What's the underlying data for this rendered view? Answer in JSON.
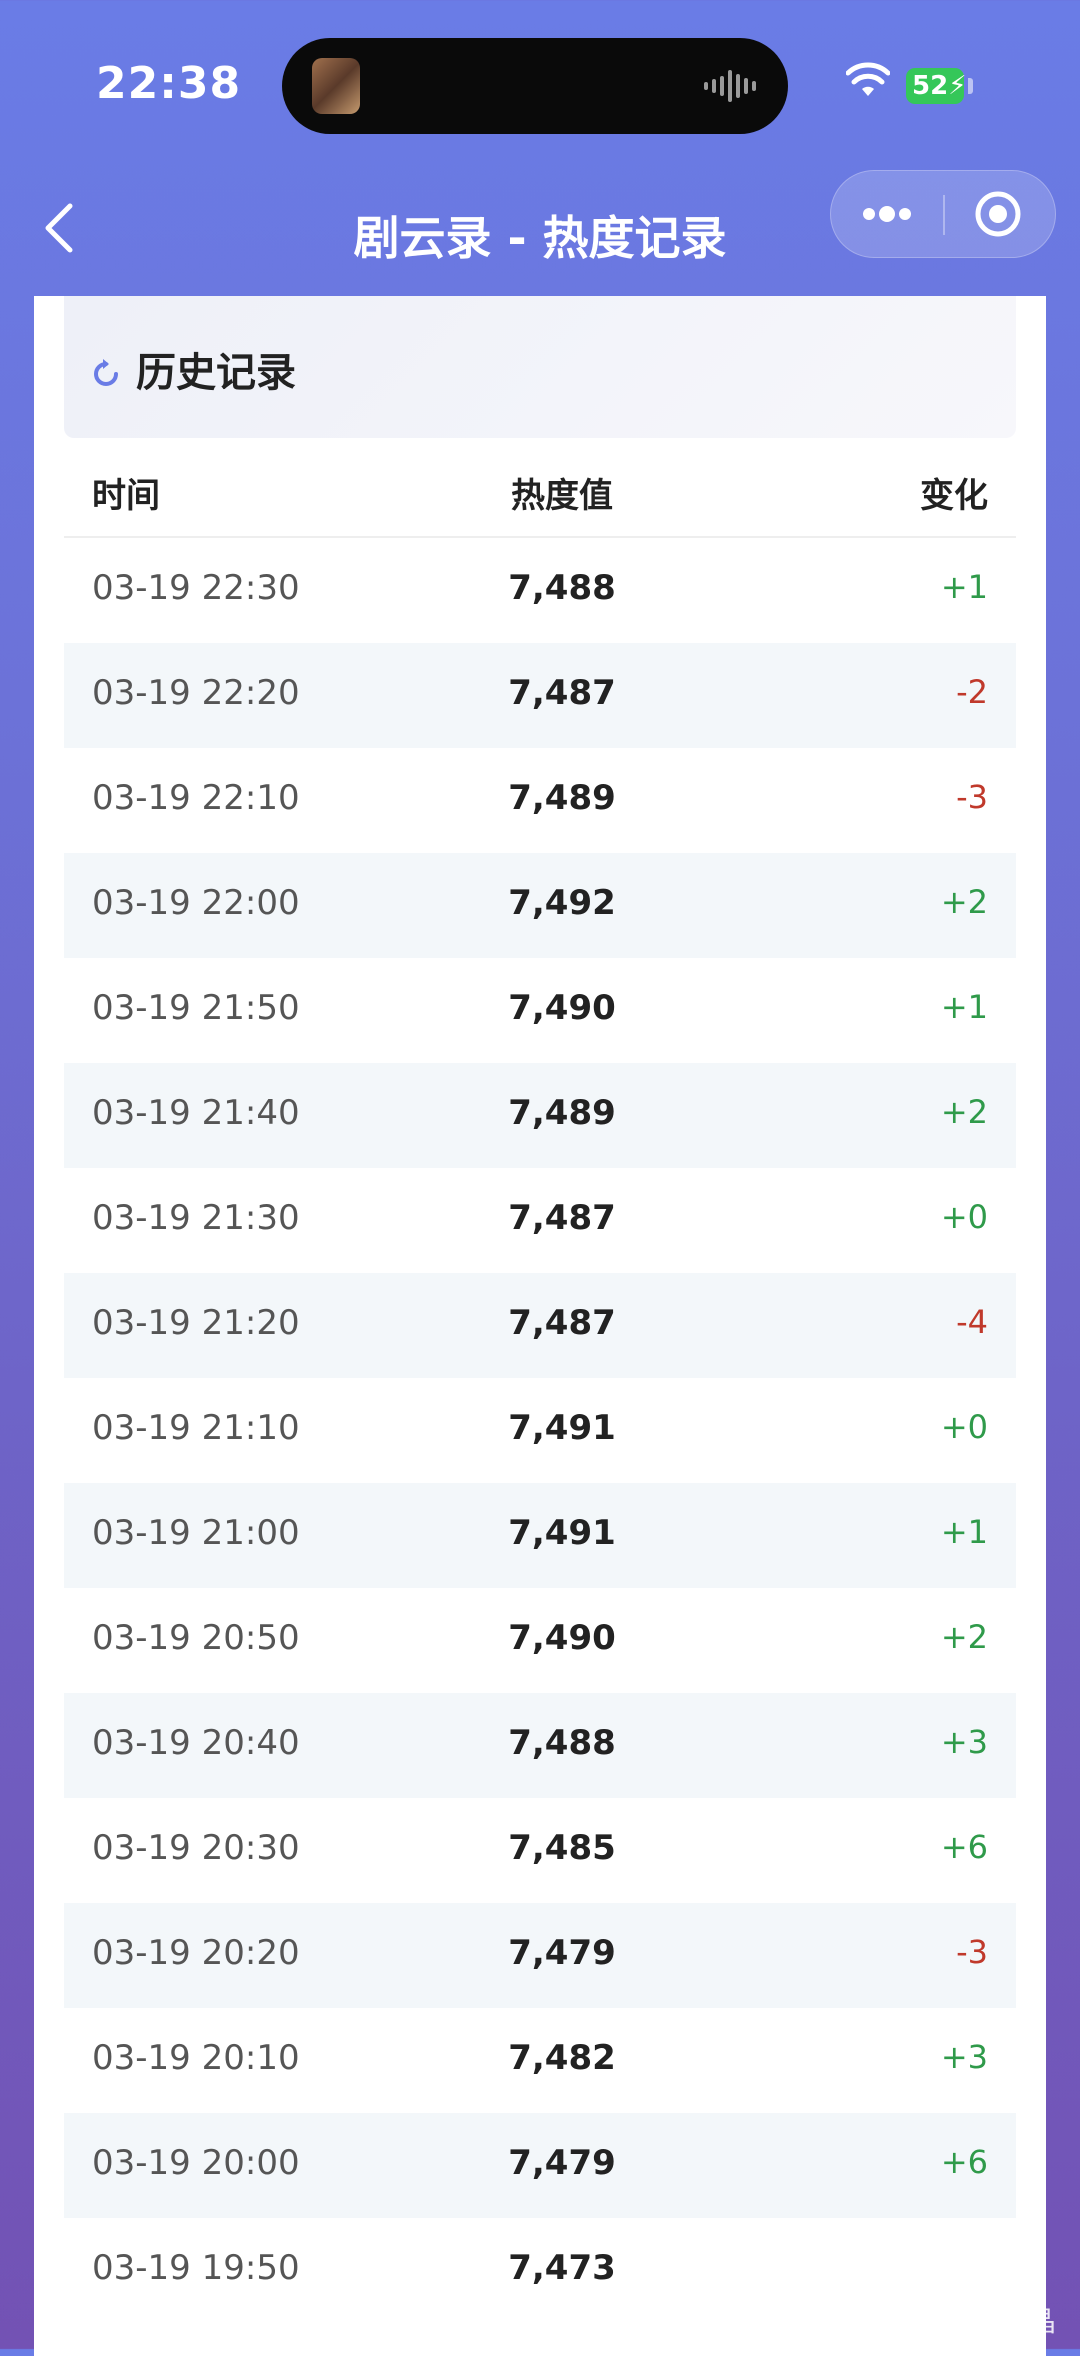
{
  "status_bar": {
    "time": "22:38",
    "battery": "52"
  },
  "nav": {
    "title": "剧云录 - 热度记录"
  },
  "card": {
    "title": "历史记录",
    "columns": {
      "time": "时间",
      "value": "热度值",
      "change": "变化"
    },
    "rows": [
      {
        "time": "03-19 22:30",
        "value": "7,488",
        "change": "+1"
      },
      {
        "time": "03-19 22:20",
        "value": "7,487",
        "change": "-2"
      },
      {
        "time": "03-19 22:10",
        "value": "7,489",
        "change": "-3"
      },
      {
        "time": "03-19 22:00",
        "value": "7,492",
        "change": "+2"
      },
      {
        "time": "03-19 21:50",
        "value": "7,490",
        "change": "+1"
      },
      {
        "time": "03-19 21:40",
        "value": "7,489",
        "change": "+2"
      },
      {
        "time": "03-19 21:30",
        "value": "7,487",
        "change": "+0"
      },
      {
        "time": "03-19 21:20",
        "value": "7,487",
        "change": "-4"
      },
      {
        "time": "03-19 21:10",
        "value": "7,491",
        "change": "+0"
      },
      {
        "time": "03-19 21:00",
        "value": "7,491",
        "change": "+1"
      },
      {
        "time": "03-19 20:50",
        "value": "7,490",
        "change": "+2"
      },
      {
        "time": "03-19 20:40",
        "value": "7,488",
        "change": "+3"
      },
      {
        "time": "03-19 20:30",
        "value": "7,485",
        "change": "+6"
      },
      {
        "time": "03-19 20:20",
        "value": "7,479",
        "change": "-3"
      },
      {
        "time": "03-19 20:10",
        "value": "7,482",
        "change": "+3"
      },
      {
        "time": "03-19 20:00",
        "value": "7,479",
        "change": "+6"
      },
      {
        "time": "03-19 19:50",
        "value": "7,473",
        "change": ""
      }
    ]
  },
  "watermark": "@戏晶晶晶晶晶",
  "colors": {
    "positive": "#2f9a4a",
    "negative": "#c0392b",
    "header_bg": "#6A7CE6"
  }
}
